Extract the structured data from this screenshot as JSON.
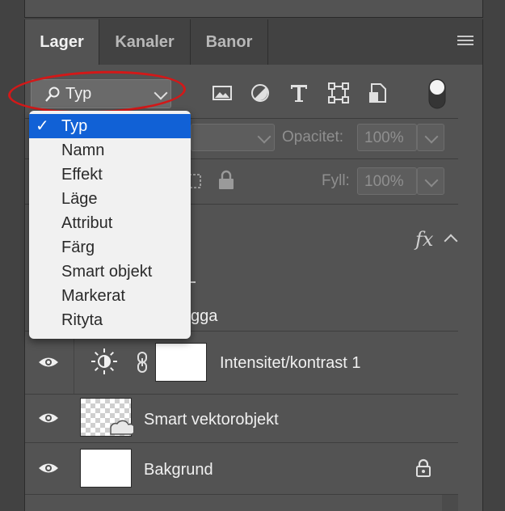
{
  "tabs": [
    {
      "label": "Lager",
      "active": true
    },
    {
      "label": "Kanaler",
      "active": false
    },
    {
      "label": "Banor",
      "active": false
    }
  ],
  "filter": {
    "selected": "Typ",
    "icons": [
      "image-filter-icon",
      "adjustment-filter-icon",
      "type-filter-icon",
      "shape-filter-icon",
      "smart-object-filter-icon",
      "filter-toggle-switch"
    ]
  },
  "dropdown": {
    "selected": "Typ",
    "options": [
      "Typ",
      "Namn",
      "Effekt",
      "Läge",
      "Attribut",
      "Färg",
      "Smart objekt",
      "Markerat",
      "Rityta"
    ]
  },
  "blend": {
    "opacity_label": "Opacitet:",
    "opacity_value": "100%",
    "fill_label": "Fyll:",
    "fill_value": "100%"
  },
  "layers": {
    "group_fx": "fx",
    "group_partial_name": "gga",
    "items": [
      {
        "name": "Intensitet/kontrast 1",
        "type": "adjustment"
      },
      {
        "name": "Smart vektorobjekt",
        "type": "smart-object"
      },
      {
        "name": "Bakgrund",
        "type": "background",
        "locked": true
      }
    ]
  },
  "colors": {
    "panel": "#535353",
    "selection": "#1161d6",
    "highlight_oval": "#d31818"
  }
}
